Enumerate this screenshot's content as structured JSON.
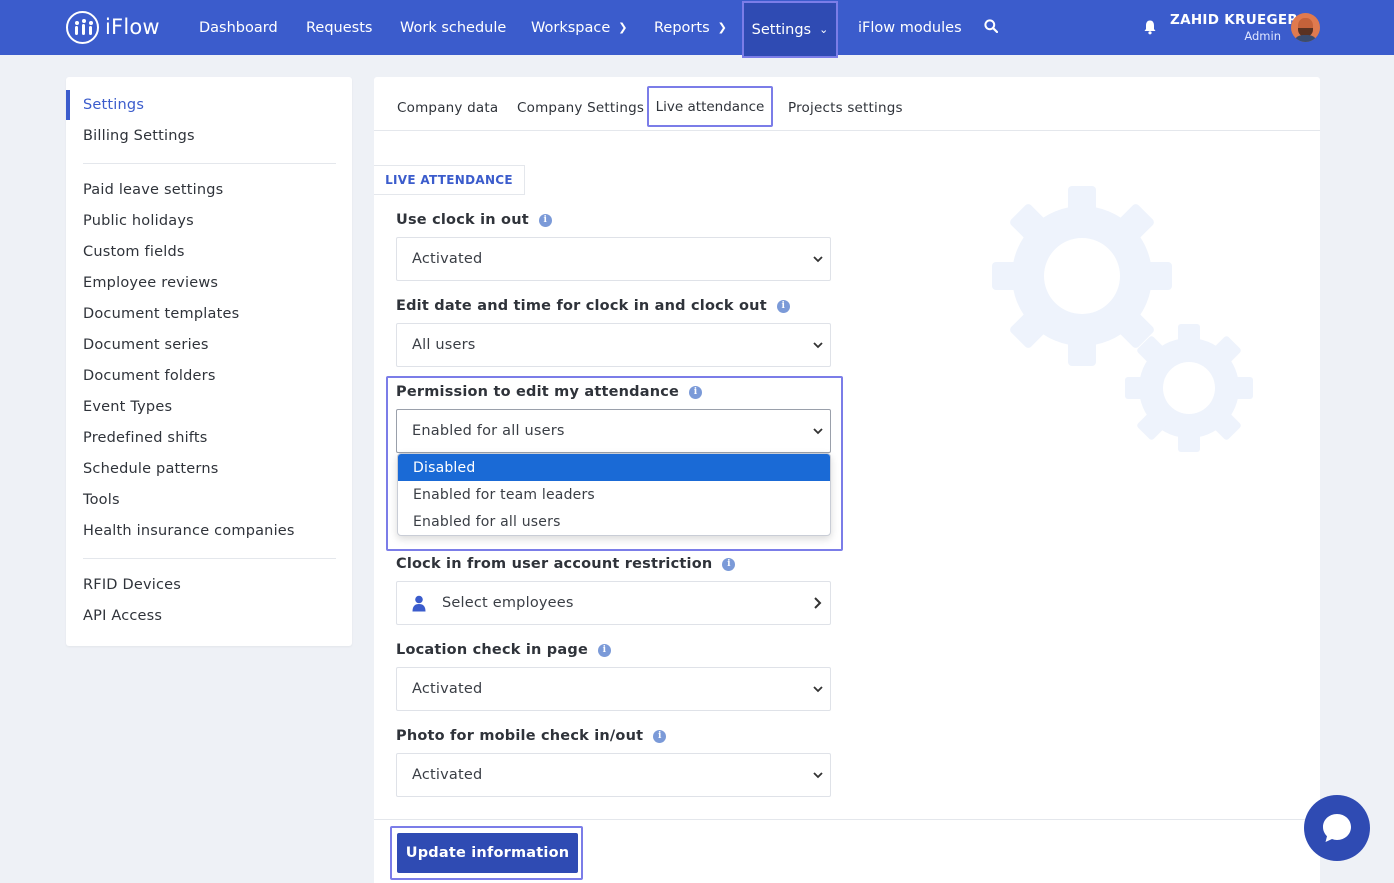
{
  "brand": {
    "name": "iFlow"
  },
  "nav": {
    "dashboard": "Dashboard",
    "requests": "Requests",
    "work_schedule": "Work schedule",
    "workspace": "Workspace",
    "reports": "Reports",
    "settings": "Settings",
    "iflow_modules": "iFlow modules"
  },
  "user": {
    "name": "ZAHID KRUEGER",
    "role": "Admin"
  },
  "sidebar": {
    "settings": "Settings",
    "billing_settings": "Billing Settings",
    "paid_leave_settings": "Paid leave settings",
    "public_holidays": "Public holidays",
    "custom_fields": "Custom fields",
    "employee_reviews": "Employee reviews",
    "document_templates": "Document templates",
    "document_series": "Document series",
    "document_folders": "Document folders",
    "event_types": "Event Types",
    "predefined_shifts": "Predefined shifts",
    "schedule_patterns": "Schedule patterns",
    "tools": "Tools",
    "health_insurance_companies": "Health insurance companies",
    "rfid_devices": "RFID Devices",
    "api_access": "API Access"
  },
  "tabs": {
    "company_data": "Company data",
    "company_settings": "Company Settings",
    "live_attendance": "Live attendance",
    "projects_settings": "Projects settings"
  },
  "section": {
    "title": "LIVE ATTENDANCE"
  },
  "fields": {
    "use_clock_in_out": {
      "label": "Use clock in out",
      "value": "Activated"
    },
    "edit_date_time": {
      "label": "Edit date and time for clock in and clock out",
      "value": "All users"
    },
    "permission_edit_attendance": {
      "label": "Permission to edit my attendance",
      "value": "Enabled for all users",
      "options": {
        "disabled": "Disabled",
        "team_leaders": "Enabled for team leaders",
        "all_users": "Enabled for all users"
      }
    },
    "clock_in_restriction": {
      "label": "Clock in from user account restriction",
      "value": "Select employees"
    },
    "location_check_in": {
      "label": "Location check in page",
      "value": "Activated"
    },
    "photo_mobile": {
      "label": "Photo for mobile check in/out",
      "value": "Activated"
    }
  },
  "actions": {
    "update": "Update information"
  },
  "colors": {
    "primary": "#3b5ccc",
    "primary_dark": "#2f4bb3",
    "highlight": "#7b7de8",
    "option_selected": "#1a6ad6"
  }
}
